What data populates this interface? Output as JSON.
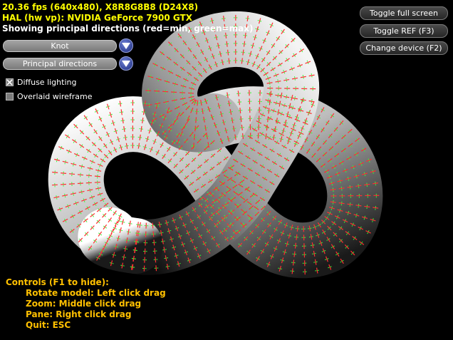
{
  "stats": {
    "fps": "20.36 fps (640x480), X8R8G8B8 (D24X8)",
    "device": "HAL (hw vp): NVIDIA GeForce 7900 GTX",
    "mode": "Showing principal directions (red=min, green=max)"
  },
  "ui": {
    "model_combo": "Knot",
    "view_combo": "Principal directions",
    "diffuse": "Diffuse lighting",
    "diffuse_checked": true,
    "wireframe": "Overlaid wireframe",
    "wireframe_checked": false
  },
  "buttons": {
    "fullscreen": "Toggle full screen",
    "ref": "Toggle REF (F3)",
    "device": "Change device (F2)"
  },
  "controls": {
    "header": "Controls (F1 to hide):",
    "rotate": "Rotate model: Left click drag",
    "zoom": "Zoom: Middle click drag",
    "pane": "Pane: Right click drag",
    "quit": "Quit: ESC"
  },
  "colors": {
    "stat_text": "#ffff00",
    "help_text": "#ffc000",
    "min_direction": "#ff3030",
    "max_direction": "#30ff30"
  }
}
